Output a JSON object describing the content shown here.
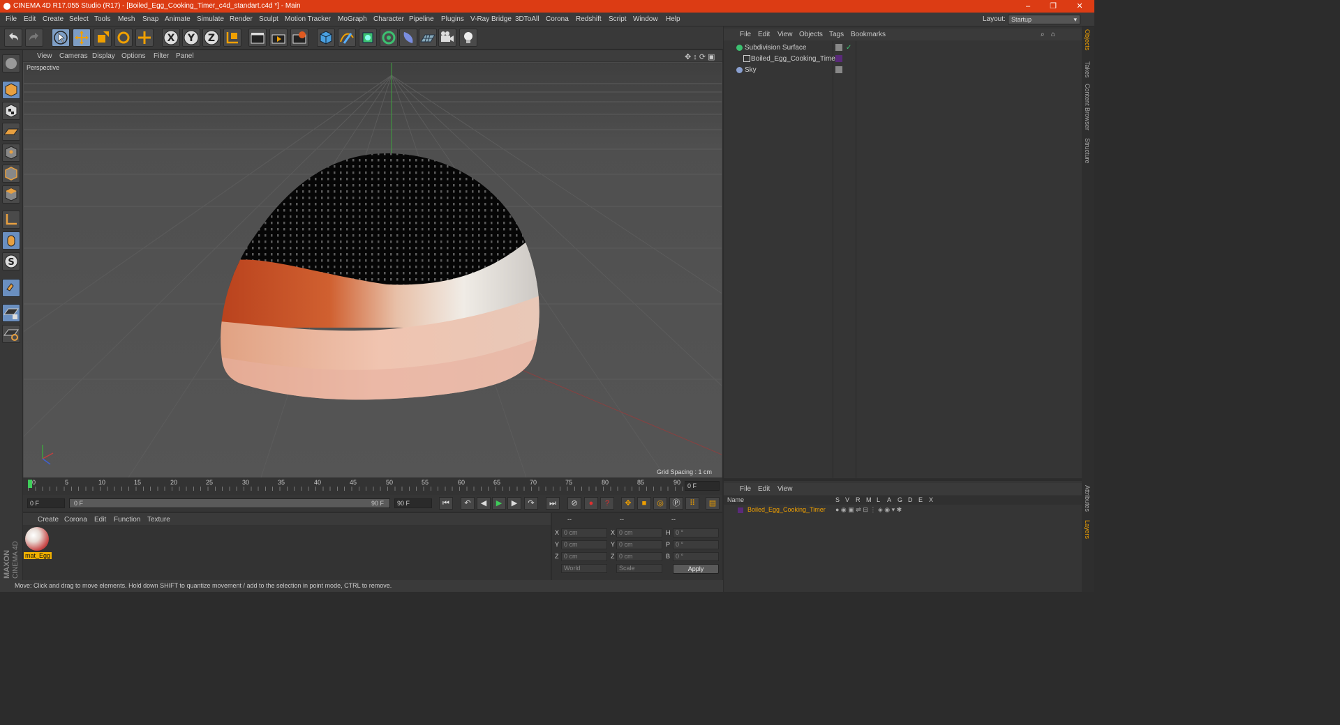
{
  "window": {
    "title": "CINEMA 4D R17.055 Studio (R17) - [Boiled_Egg_Cooking_Timer_c4d_standart.c4d *] - Main",
    "minimize": "–",
    "maximize": "❐",
    "close": "✕"
  },
  "menu": [
    "File",
    "Edit",
    "Create",
    "Select",
    "Tools",
    "Mesh",
    "Snap",
    "Animate",
    "Simulate",
    "Render",
    "Sculpt",
    "Motion Tracker",
    "MoGraph",
    "Character",
    "Pipeline",
    "Plugins",
    "V-Ray Bridge",
    "3DToAll",
    "Corona",
    "Redshift",
    "Script",
    "Window",
    "Help"
  ],
  "layout": {
    "label": "Layout:",
    "value": "Startup"
  },
  "toolbar": {
    "axis_x": "X",
    "axis_y": "Y",
    "axis_z": "Z"
  },
  "viewport": {
    "menu": [
      "View",
      "Cameras",
      "Display",
      "Options",
      "Filter",
      "Panel"
    ],
    "label": "Perspective",
    "grid_spacing": "Grid Spacing : 1 cm"
  },
  "timeline": {
    "ticks": [
      "0",
      "5",
      "10",
      "15",
      "20",
      "25",
      "30",
      "35",
      "40",
      "45",
      "50",
      "55",
      "60",
      "65",
      "70",
      "75",
      "80",
      "85",
      "90"
    ],
    "current_frame": "0 F",
    "start_field": "0 F",
    "range_start": "0 F",
    "range_end": "90 F",
    "end_field": "90 F"
  },
  "material_manager": {
    "menu": [
      "Create",
      "Corona",
      "Edit",
      "Function",
      "Texture"
    ],
    "material_name": "mat_Egg"
  },
  "coords": {
    "header": [
      "--",
      "--",
      "--"
    ],
    "rows": [
      {
        "a": "X",
        "av": "0 cm",
        "b": "X",
        "bv": "0 cm",
        "c": "H",
        "cv": "0 °"
      },
      {
        "a": "Y",
        "av": "0 cm",
        "b": "Y",
        "bv": "0 cm",
        "c": "P",
        "cv": "0 °"
      },
      {
        "a": "Z",
        "av": "0 cm",
        "b": "Z",
        "bv": "0 cm",
        "c": "B",
        "cv": "0 °"
      }
    ],
    "world": "World",
    "scale": "Scale",
    "apply": "Apply"
  },
  "status": "Move: Click and drag to move elements. Hold down SHIFT to quantize movement / add to the selection in point mode, CTRL to remove.",
  "objects": {
    "menu": [
      "File",
      "Edit",
      "View",
      "Objects",
      "Tags",
      "Bookmarks"
    ],
    "items": [
      "Subdivision Surface",
      "Boiled_Egg_Cooking_Timer",
      "Sky"
    ]
  },
  "layers": {
    "menu": [
      "File",
      "Edit",
      "View"
    ],
    "header_name": "Name",
    "flags": [
      "S",
      "V",
      "R",
      "M",
      "L",
      "A",
      "G",
      "D",
      "E",
      "X"
    ],
    "row_name": "Boiled_Egg_Cooking_Timer"
  },
  "right_tabs": [
    "Objects",
    "Takes",
    "Content Browser",
    "Structure",
    "Attributes",
    "Layers"
  ],
  "brand": {
    "maxon": "MAXON",
    "c4d": "CINEMA 4D"
  }
}
